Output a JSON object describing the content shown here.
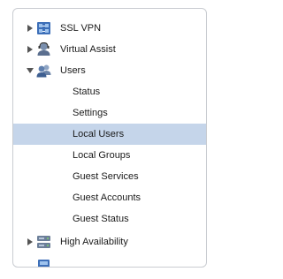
{
  "tree": {
    "items": [
      {
        "label": "SSL VPN",
        "icon": "ssl-vpn-icon",
        "expanded": false
      },
      {
        "label": "Virtual Assist",
        "icon": "virtual-assist-icon",
        "expanded": false
      },
      {
        "label": "Users",
        "icon": "users-icon",
        "expanded": true,
        "children": [
          {
            "label": "Status"
          },
          {
            "label": "Settings"
          },
          {
            "label": "Local Users",
            "selected": true
          },
          {
            "label": "Local Groups"
          },
          {
            "label": "Guest Services"
          },
          {
            "label": "Guest Accounts"
          },
          {
            "label": "Guest Status"
          }
        ]
      },
      {
        "label": "High Availability",
        "icon": "high-availability-icon",
        "expanded": false
      }
    ]
  },
  "colors": {
    "selection": "#c5d5ea",
    "border": "#c9ccd1",
    "text": "#1a1a1a"
  }
}
